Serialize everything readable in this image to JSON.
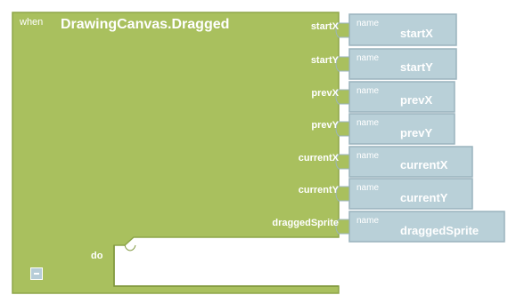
{
  "block": {
    "keyword": "when",
    "event": "DrawingCanvas.Dragged",
    "do_label": "do",
    "colors": {
      "event_fill": "#a9c05e",
      "event_stroke": "#8da548",
      "param_fill": "#b9d0d8",
      "param_stroke": "#9ab3bd",
      "text": "#ffffff"
    },
    "params": [
      {
        "label": "startX",
        "name_word": "name",
        "value": "startX"
      },
      {
        "label": "startY",
        "name_word": "name",
        "value": "startY"
      },
      {
        "label": "prevX",
        "name_word": "name",
        "value": "prevX"
      },
      {
        "label": "prevY",
        "name_word": "name",
        "value": "prevY"
      },
      {
        "label": "currentX",
        "name_word": "name",
        "value": "currentX"
      },
      {
        "label": "currentY",
        "name_word": "name",
        "value": "currentY"
      },
      {
        "label": "draggedSprite",
        "name_word": "name",
        "value": "draggedSprite"
      }
    ]
  }
}
